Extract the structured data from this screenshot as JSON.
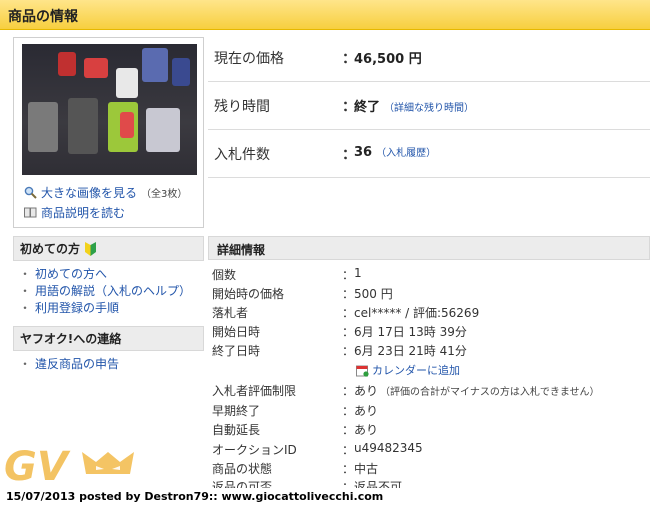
{
  "header": {
    "title": "商品の情報"
  },
  "photo": {
    "enlarge_label": "大きな画像を見る",
    "count_label": "（全3枚）",
    "description_label": "商品説明を読む"
  },
  "summary": [
    {
      "label": "現在の価格",
      "value": "46,500 円",
      "link": ""
    },
    {
      "label": "残り時間",
      "value": "終了",
      "link": "（詳細な残り時間）"
    },
    {
      "label": "入札件数",
      "value": "36",
      "link": "（入札履歴）"
    }
  ],
  "sidebar": {
    "beginners": {
      "title": "初めての方",
      "items": [
        "初めての方へ",
        "用語の解説（入札のヘルプ）",
        "利用登録の手順"
      ]
    },
    "contact": {
      "title": "ヤフオク!への連絡",
      "items": [
        "違反商品の申告"
      ]
    }
  },
  "details": {
    "title": "詳細情報",
    "rows": [
      {
        "label": "個数",
        "value": "1",
        "note": ""
      },
      {
        "label": "開始時の価格",
        "value": "500 円",
        "note": ""
      },
      {
        "label": "落札者",
        "value": "cel***** / 評価:56269",
        "note": ""
      },
      {
        "label": "開始日時",
        "value": "6月 17日 13時 39分",
        "note": ""
      },
      {
        "label": "終了日時",
        "value": "6月 23日 21時 41分",
        "note": ""
      },
      {
        "label": "入札者評価制限",
        "value": "あり",
        "note": "（評価の合計がマイナスの方は入札できません）"
      },
      {
        "label": "早期終了",
        "value": "あり",
        "note": ""
      },
      {
        "label": "自動延長",
        "value": "あり",
        "note": ""
      },
      {
        "label": "オークションID",
        "value": "u49482345",
        "note": ""
      },
      {
        "label": "商品の状態",
        "value": "中古",
        "note": ""
      },
      {
        "label": "返品の可否",
        "value": "返品不可",
        "note": ""
      }
    ],
    "calendar_label": "カレンダーに追加"
  },
  "watermark": {
    "text": "GV"
  },
  "footer": {
    "text": "15/07/2013 posted by Destron79:: www.giocattolivecchi.com"
  },
  "colors": {
    "header_bg": "#f7cf3f",
    "link": "#2255aa",
    "section_bg": "#ececec",
    "watermark": "#f0b030"
  }
}
